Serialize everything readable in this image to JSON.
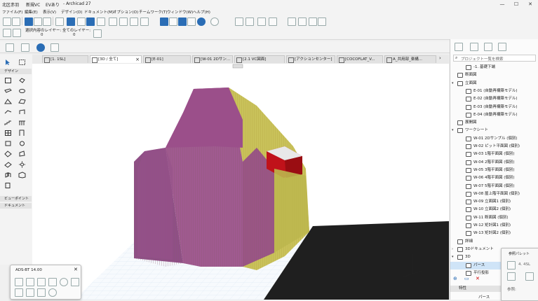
{
  "titlebar": {
    "project": "北区赤羽",
    "team": "新規VC",
    "ev": "EVあり",
    "app": "- Archicad 27",
    "controls": [
      "—",
      "☐",
      "✕"
    ]
  },
  "menu": [
    "ファイル(F)",
    "編集(E)",
    "表示(V)",
    "デザイン(D)",
    "ドキュメント(M)",
    "オプション(O)",
    "チームワーク(T)",
    "ウィンドウ(W)",
    "ヘルプ(H)"
  ],
  "layer_toolbar": {
    "line1": "選択内容のレイヤー: 全てのレイヤー:",
    "count1": "0",
    "count2": "0"
  },
  "tabs": [
    {
      "label": "[1. 1SL]",
      "active": false
    },
    {
      "label": "[3D / 全て]",
      "active": true
    },
    {
      "label": "[E-01]",
      "active": false
    },
    {
      "label": "[W-01 2Dサン...",
      "active": false
    },
    {
      "label": "[2.1 VC図面]",
      "active": false
    },
    {
      "label": "[アクションセンター]",
      "active": false
    },
    {
      "label": "[COCOFLAT_V...",
      "active": false
    },
    {
      "label": "A_共用部_楽構...",
      "active": false
    }
  ],
  "toolbox": {
    "design_label": "デザイン",
    "viewpoint_label": "ビューポイント",
    "document_label": "ドキュメント"
  },
  "navigator": {
    "search_placeholder": "プロジェクト一覧を検索",
    "items": [
      {
        "label": "-1. 基礎下端",
        "indent": 1,
        "arrow": ""
      },
      {
        "label": "断面図",
        "indent": 0,
        "arrow": ""
      },
      {
        "label": "立面図",
        "indent": 0,
        "arrow": "▾"
      },
      {
        "label": "E-01 (自動再構築モデル)",
        "indent": 1,
        "arrow": ""
      },
      {
        "label": "E-02 (自動再構築モデル)",
        "indent": 1,
        "arrow": ""
      },
      {
        "label": "E-03 (自動再構築モデル)",
        "indent": 1,
        "arrow": ""
      },
      {
        "label": "E-04 (自動再構築モデル)",
        "indent": 1,
        "arrow": ""
      },
      {
        "label": "展開図",
        "indent": 0,
        "arrow": ""
      },
      {
        "label": "ワークシート",
        "indent": 0,
        "arrow": "▾"
      },
      {
        "label": "W-01 2Dサンプル (個別)",
        "indent": 1,
        "arrow": ""
      },
      {
        "label": "W-02 ピット平面図 (個別)",
        "indent": 1,
        "arrow": ""
      },
      {
        "label": "W-03 1階平面図 (個別)",
        "indent": 1,
        "arrow": ""
      },
      {
        "label": "W-04 2階平面図 (個別)",
        "indent": 1,
        "arrow": ""
      },
      {
        "label": "W-05 3階平面図 (個別)",
        "indent": 1,
        "arrow": ""
      },
      {
        "label": "W-06 4階平面図 (個別)",
        "indent": 1,
        "arrow": ""
      },
      {
        "label": "W-07 5階平面図 (個別)",
        "indent": 1,
        "arrow": ""
      },
      {
        "label": "W-08 屋上階平面図 (個別)",
        "indent": 1,
        "arrow": ""
      },
      {
        "label": "W-09 立面図1 (個別)",
        "indent": 1,
        "arrow": ""
      },
      {
        "label": "W-10 立面図2 (個別)",
        "indent": 1,
        "arrow": ""
      },
      {
        "label": "W-11 断面図 (個別)",
        "indent": 1,
        "arrow": ""
      },
      {
        "label": "W-12 矩計図1 (個別)",
        "indent": 1,
        "arrow": ""
      },
      {
        "label": "W-13 矩計図2 (個別)",
        "indent": 1,
        "arrow": ""
      },
      {
        "label": "詳細",
        "indent": 0,
        "arrow": ""
      },
      {
        "label": "3Dドキュメント",
        "indent": 0,
        "arrow": "›"
      },
      {
        "label": "3D",
        "indent": 0,
        "arrow": "▾"
      },
      {
        "label": "パース",
        "indent": 1,
        "arrow": "",
        "selected": true
      },
      {
        "label": "平行投影",
        "indent": 1,
        "arrow": ""
      }
    ],
    "properties_label": "特性",
    "properties_value": "パース"
  },
  "palette": {
    "title": "ADS-BT 14.00",
    "close": "✕"
  },
  "ref_palette": {
    "title": "参照パレット",
    "value": "4. 4SL",
    "ref_label": "参照:"
  }
}
